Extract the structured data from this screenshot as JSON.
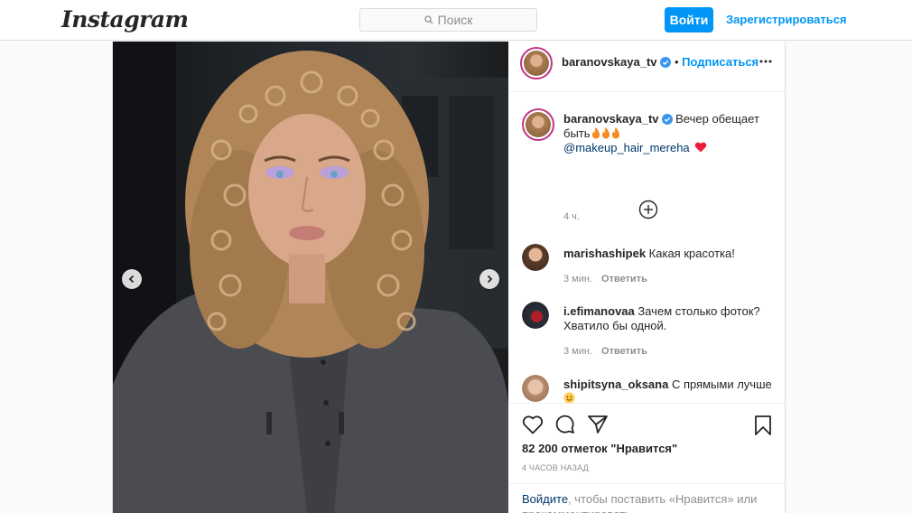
{
  "header": {
    "logo": "Instagram",
    "search_placeholder": "Поиск",
    "login_label": "Войти",
    "signup_label": "Зарегистрироваться"
  },
  "post": {
    "author": "baranovskaya_tv",
    "follow_label": "Подписаться",
    "more_icon": "more-horizontal-icon",
    "caption": {
      "username": "baranovskaya_tv",
      "text": "Вечер обещает быть",
      "mention": "@makeup_hair_mereha",
      "time": "4 ч."
    },
    "comments": [
      {
        "username": "marishashipek",
        "text": "Какая красотка!",
        "time": "3 мин.",
        "reply_label": "Ответить"
      },
      {
        "username": "i.efimanovaa",
        "text": "Зачем столько фоток? Хватило бы одной.",
        "time": "3 мин.",
        "reply_label": "Ответить"
      },
      {
        "username": "shipitsyna_oksana",
        "text": "С прямыми лучше"
      }
    ],
    "likes_text": "82 200 отметок \"Нравится\"",
    "posted_ago": "4 ЧАСОВ НАЗАД",
    "login_prompt": {
      "link": "Войдите",
      "text": ", чтобы поставить «Нравится» или прокомментировать."
    }
  },
  "colors": {
    "accent": "#0095f6",
    "verified": "#3897f0",
    "heart": "#ed4956"
  }
}
